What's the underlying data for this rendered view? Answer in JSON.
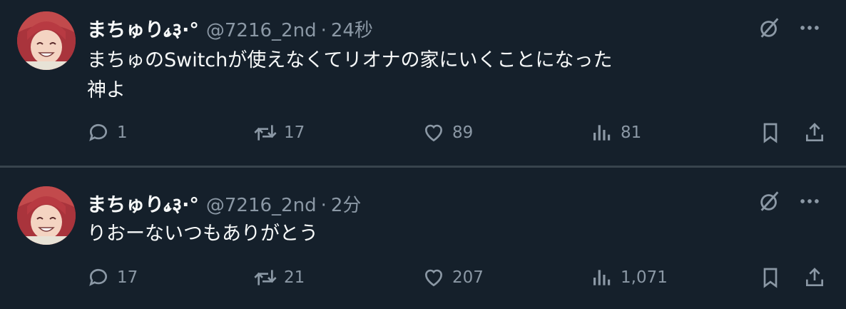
{
  "tweets": [
    {
      "display_name": "まちゅり𝓼३·°",
      "handle": "@7216_2nd",
      "separator": "·",
      "time": "24秒",
      "text_lines": [
        "まちゅのSwitchが使えなくてリオナの家にいくことになった",
        "神よ"
      ],
      "replies": "1",
      "retweets": "17",
      "likes": "89",
      "views": "81"
    },
    {
      "display_name": "まちゅり𝓼३·°",
      "handle": "@7216_2nd",
      "separator": "·",
      "time": "2分",
      "text_lines": [
        "りおーないつもありがとう"
      ],
      "replies": "17",
      "retweets": "21",
      "likes": "207",
      "views": "1,071"
    }
  ],
  "icons": {
    "grok": "slashed-circle-icon",
    "more": "more-dots-icon",
    "reply": "reply-bubble-icon",
    "retweet": "retweet-icon",
    "like": "heart-icon",
    "views": "views-bars-icon",
    "bookmark": "bookmark-icon",
    "share": "share-icon"
  },
  "colors": {
    "background": "#15202b",
    "divider": "#38444d",
    "text_primary": "#f7f9f9",
    "text_secondary": "#8b98a5"
  }
}
